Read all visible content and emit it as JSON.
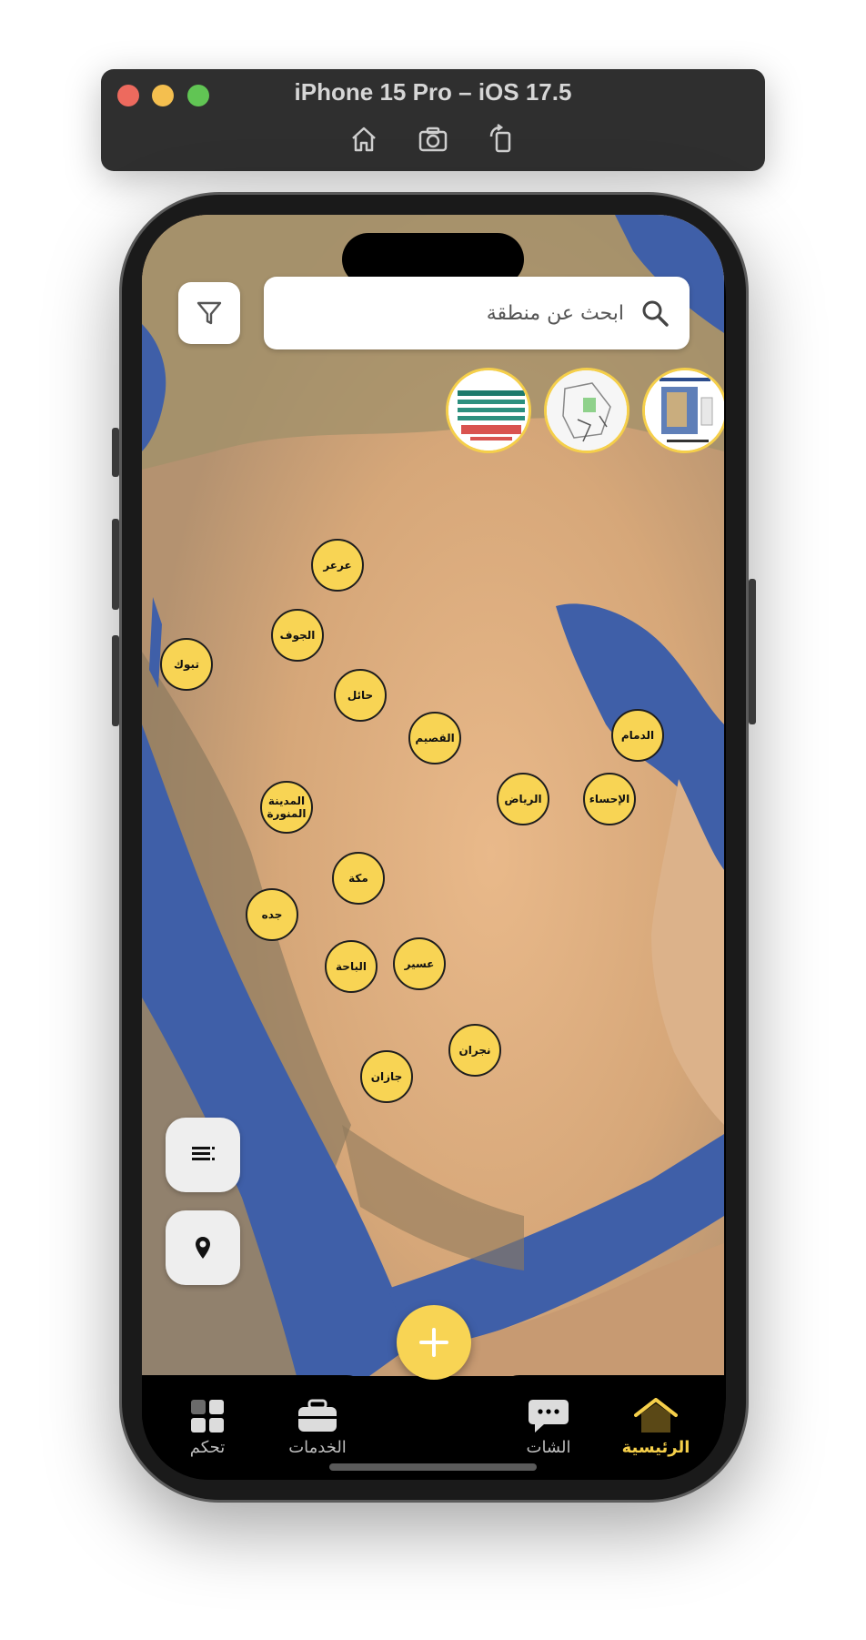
{
  "simulator": {
    "title": "iPhone 15 Pro – iOS 17.5",
    "tools": [
      "home-icon",
      "screenshot-icon",
      "rotate-icon"
    ]
  },
  "search": {
    "placeholder": "ابحث عن منطقة"
  },
  "cities": [
    {
      "id": "arar",
      "label": "عرعر"
    },
    {
      "id": "jouf",
      "label": "الجوف"
    },
    {
      "id": "tabuk",
      "label": "تبوك"
    },
    {
      "id": "hail",
      "label": "حائل"
    },
    {
      "id": "qassim",
      "label": "القصيم"
    },
    {
      "id": "dammam",
      "label": "الدمام"
    },
    {
      "id": "riyadh",
      "label": "الرياض"
    },
    {
      "id": "ahsa",
      "label": "الإحساء"
    },
    {
      "id": "madinah",
      "label": "المدينة المنورة"
    },
    {
      "id": "makkah",
      "label": "مكة"
    },
    {
      "id": "jeddah",
      "label": "جده"
    },
    {
      "id": "baha",
      "label": "الباحة"
    },
    {
      "id": "asir",
      "label": "عسير"
    },
    {
      "id": "najran",
      "label": "نجران"
    },
    {
      "id": "jazan",
      "label": "جازان"
    }
  ],
  "tabs": [
    {
      "label": "تحكم",
      "icon": "grid-icon",
      "active": false
    },
    {
      "label": "الخدمات",
      "icon": "briefcase-icon",
      "active": false
    },
    {
      "label": "الشات",
      "icon": "chat-icon",
      "active": false
    },
    {
      "label": "الرئيسية",
      "icon": "home-icon",
      "active": true
    }
  ],
  "colors": {
    "accent": "#f8d454",
    "active_tab": "#f5cf4a",
    "sea": "#3f5fa8",
    "desert": "#d8a878"
  }
}
